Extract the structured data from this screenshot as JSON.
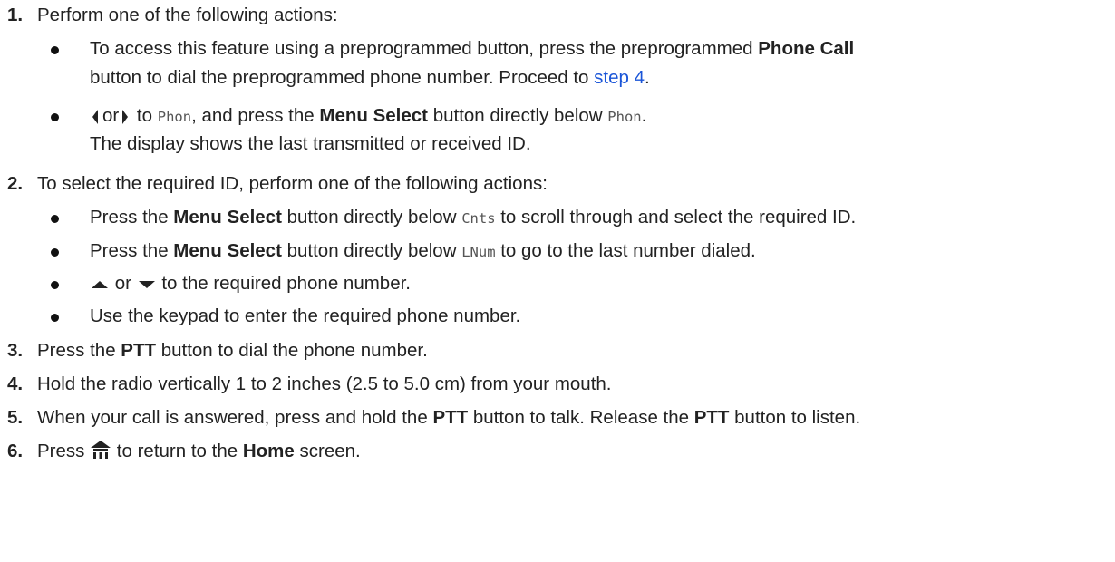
{
  "steps": [
    {
      "num": "1.",
      "text": "Perform one of the following actions:"
    },
    {
      "num": "2.",
      "text": "To select the required ID, perform one of the following actions:"
    },
    {
      "num": "3.",
      "pre": "Press the ",
      "bold": "PTT",
      "post": " button to dial the phone number."
    },
    {
      "num": "4.",
      "text": "Hold the radio vertically 1 to 2 inches (2.5 to 5.0 cm) from your mouth."
    },
    {
      "num": "5.",
      "pre": "When your call is answered, press and hold the ",
      "bold": "PTT",
      "mid": " button to talk. Release the ",
      "bold2": "PTT",
      "post": " button to listen."
    },
    {
      "num": "6.",
      "pre": "Press ",
      "mid": " to return to the ",
      "bold": "Home",
      "post": " screen."
    }
  ],
  "step1_options": [
    {
      "pre": "To access this feature using a preprogrammed button, press the preprogrammed ",
      "bold": "Phone Call",
      "line2": "button to dial the preprogrammed phone number. Proceed to ",
      "link": "step 4",
      "end": "."
    },
    {
      "or": "or",
      "to": " to ",
      "mono": "Phon",
      "mid": ", and press the ",
      "bold": "Menu Select",
      "post": " button directly below ",
      "mono2": "Phon",
      "end": ".",
      "note": "The display shows the last transmitted or received ID."
    }
  ],
  "step2_options": [
    {
      "pre": "Press the ",
      "bold": "Menu Select",
      "mid": " button directly below ",
      "mono": "Cnts",
      "post": " to scroll through and select the required ID."
    },
    {
      "pre": "Press the ",
      "bold": "Menu Select",
      "mid": " button directly below ",
      "mono": "LNum",
      "post": " to go to the last number dialed."
    },
    {
      "or": "or",
      "post": " to the required phone number."
    },
    {
      "text": "Use the keypad to enter the required phone number."
    }
  ],
  "icons": [
    "left-arrow-icon",
    "right-arrow-icon",
    "up-arrow-icon",
    "down-arrow-icon",
    "home-icon"
  ]
}
